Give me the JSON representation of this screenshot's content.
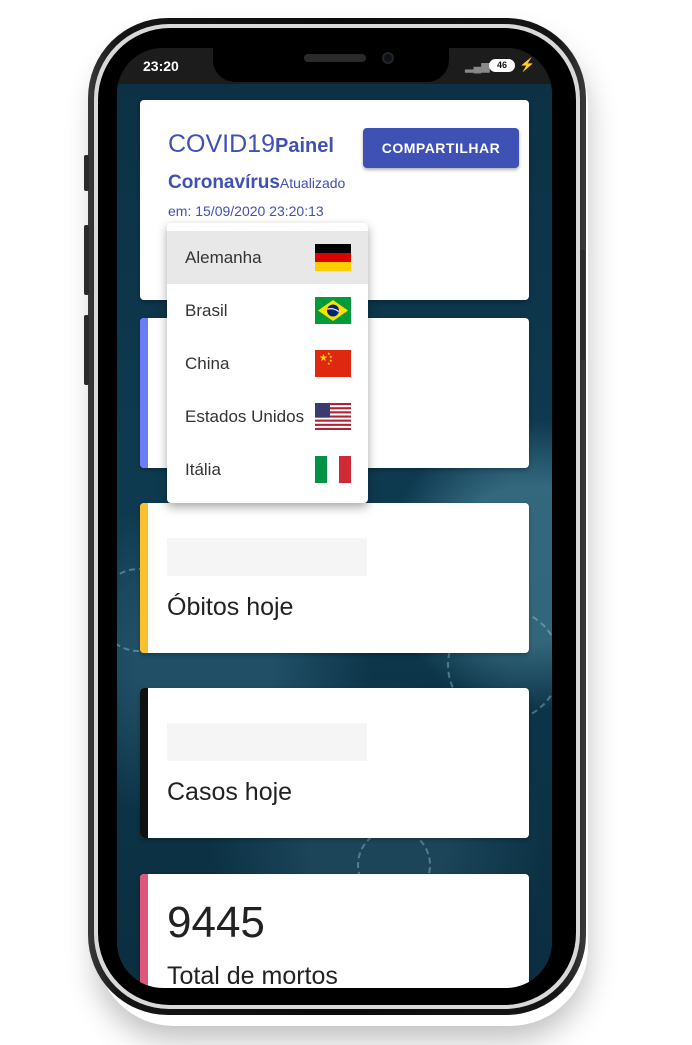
{
  "status_bar": {
    "time": "23:20",
    "battery": "46"
  },
  "header": {
    "title_part1": "COVID19",
    "title_part2": "Painel",
    "subtitle_bold": "Coronavírus",
    "subtitle_small": "Atualizado",
    "updated": "em: 15/09/2020 23:20:13",
    "share_button": "COMPARTILHAR"
  },
  "dropdown": {
    "items": [
      {
        "label": "Alemanha",
        "flag": "germany-flag",
        "selected": true
      },
      {
        "label": "Brasil",
        "flag": "brazil-flag",
        "selected": false
      },
      {
        "label": "China",
        "flag": "china-flag",
        "selected": false
      },
      {
        "label": "Estados Unidos",
        "flag": "usa-flag",
        "selected": false
      },
      {
        "label": "Itália",
        "flag": "italy-flag",
        "selected": false
      }
    ]
  },
  "cards": {
    "deaths_today": {
      "label": "Óbitos hoje",
      "accent": "#fbc02d"
    },
    "cases_today": {
      "label": "Casos hoje",
      "accent": "#111111"
    },
    "total_deaths": {
      "value": "9445",
      "label": "Total de mortos",
      "accent": "#e0567a"
    },
    "hidden_card": {
      "accent": "#6c7cf5"
    }
  },
  "colors": {
    "primary": "#3f51b5",
    "background": "#0d3448"
  }
}
